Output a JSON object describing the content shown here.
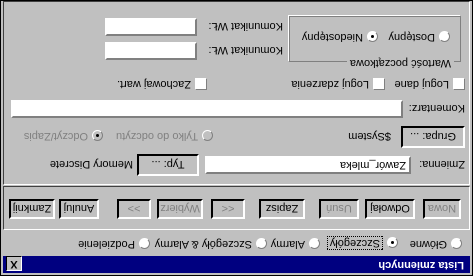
{
  "window": {
    "title": "Lista zmiennych",
    "close_label": "X"
  },
  "tabs": [
    {
      "label": "Główne",
      "checked": false
    },
    {
      "label": "Szczegóły",
      "checked": true
    },
    {
      "label": "Alarmy",
      "checked": false
    },
    {
      "label": "Szczegóły & Alarmy",
      "checked": false
    },
    {
      "label": "Podzielenie",
      "checked": false
    }
  ],
  "buttons": {
    "nowa": "Nowa",
    "odwolaj": "Odwołaj",
    "usun": "Usuń",
    "zapisz": "Zapisz",
    "prev": "<<",
    "wybierz": "Wybierz",
    "next": ">>",
    "anuluj": "Anuluj",
    "zamknij": "Zamknij"
  },
  "variable": {
    "label": "Zmienna:",
    "value": "Zawór_mleka",
    "type_button": "Typ: ...",
    "type_value": "Memory Discrete"
  },
  "group_row": {
    "group_button": "Grupa: ...",
    "group_value": "$System",
    "read_only": "Tylko do odczytu",
    "read_write": "Odczyt/Zapis"
  },
  "comment": {
    "label": "Komentarz:",
    "value": ""
  },
  "checks": {
    "log_data": "Loguj dane",
    "log_events": "Loguj zdarzenia",
    "save_value": "Zachowaj wart."
  },
  "initial_value": {
    "group_label": "Wartość początkowa",
    "on": "Dostępny",
    "off": "Niedostępny"
  },
  "messages": {
    "on_label": "Komunikat WŁ:",
    "off_label": "Komunikat WŁ:",
    "on_value": "",
    "off_value": ""
  }
}
